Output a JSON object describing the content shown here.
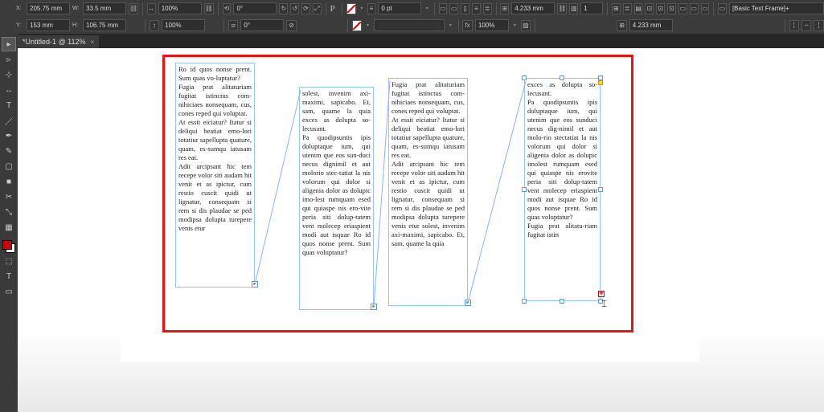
{
  "app": {
    "doc_tab": "*Untitled-1 @ 112%"
  },
  "ctrl": {
    "x_label": "X:",
    "x_val": "205.75 mm",
    "y_label": "Y:",
    "y_val": "153 mm",
    "w_label": "W:",
    "w_val": "33.5 mm",
    "h_label": "H:",
    "h_val": "106.75 mm",
    "scale_x": "100%",
    "scale_y": "100%",
    "rotate": "0°",
    "shear": "0°",
    "char_tag": "P",
    "stroke_pt": "0 pt",
    "opacity": "100%",
    "inset1": "4.233 mm",
    "inset2": "4.233 mm",
    "col_count": "1",
    "style_name": "[Basic Text Frame]+"
  },
  "frames": {
    "f1": "Ro id quos nonse prent. Sum quas vo-luptatur?\nFugia prat alitaturiam fugitat istinctus com-nihiciaes nonsequam, cus, cones reped qui voluptat.\nAt essit eiciatur? Itatur si deliqui beatiat emo-lori totatiur sapellupta quature, quam, es-sumqu iatusam res eat.\nAdit arcipsant hic tem recepe volor siti audam hit venit et as ipictur, cum restio cuscit quidi ut lignatur, consequam si rem si dis plaudae se ped modipsa dolupta turepere venis etur",
    "f2": "solest, invenim axi-maximi, sapicabo. Et, sam, quame la quia exces as dolupta so-lecusant.\nPa quodipsuntis ipis doluptaque ium, qui utenim que eos sun-duci necus dignimil et aut molorio stec-tatiat la nis volorum qui dolor si aligenia dolor as dolupic imo-lest rumquam esed qui quiaspe nis ero-vite peria siti dolup-tatem vent molecep eriaspient modi aut isquae Ro id quos nonse prent. Sum quas voluptatur?",
    "f3": "Fugia prat alitaturiam fugitat istinctus com-nihiciaes nonsequam, cus, cones reped qui voluptat.\nAt essit eiciatur? Itatur si deliqui beatiat emo-lori totatiur sapellupta quature, quam, es-sumqu iatusam res eat.\nAdit arcipsant hic tem recepe volor siti audam hit venit et as ipictur, cum restio cuscit quidi ut lignatur, consequam si rem si dis plaudae se ped modipsa dolupta turepere venis etur solest, invenim axi-maximi, sapicabo. Et, sam, quame la quia",
    "f4": "exces as dolupta so-lecusant.\nPa quodipsuntis ipis doluptaque ium, qui utenim que eos sunduci necus dig-nimil et aut molo-rio stectatiat la nis volorum qui dolor si aligenia dolor as dolupic imolest rumquam esed qui quiaspe nis erovite peria siti dolup-tatem vent molecep eriaspient modi aut isquae Ro id quos nonse prent. Sum quas voluptatur?\nFugia prat alitatu-riam fugitat istin"
  },
  "tools": [
    "▸",
    "▹",
    "⊹",
    "T",
    "/",
    "◻",
    "✎",
    "✂",
    "↗",
    "✥",
    "⊕",
    "Q"
  ],
  "topicons_a": [
    "↻",
    "↺",
    "⟳",
    "⤢"
  ],
  "topicons_b": [
    "▭",
    "▭",
    "▯",
    "≡",
    "≡",
    "≣"
  ],
  "topicons_c": [
    "⊞",
    "≣",
    "▤",
    "⊡",
    "⊡",
    "⊡",
    "▭",
    "▭",
    "▭"
  ],
  "topicons_d": [
    "╎",
    "╌",
    "╎"
  ]
}
